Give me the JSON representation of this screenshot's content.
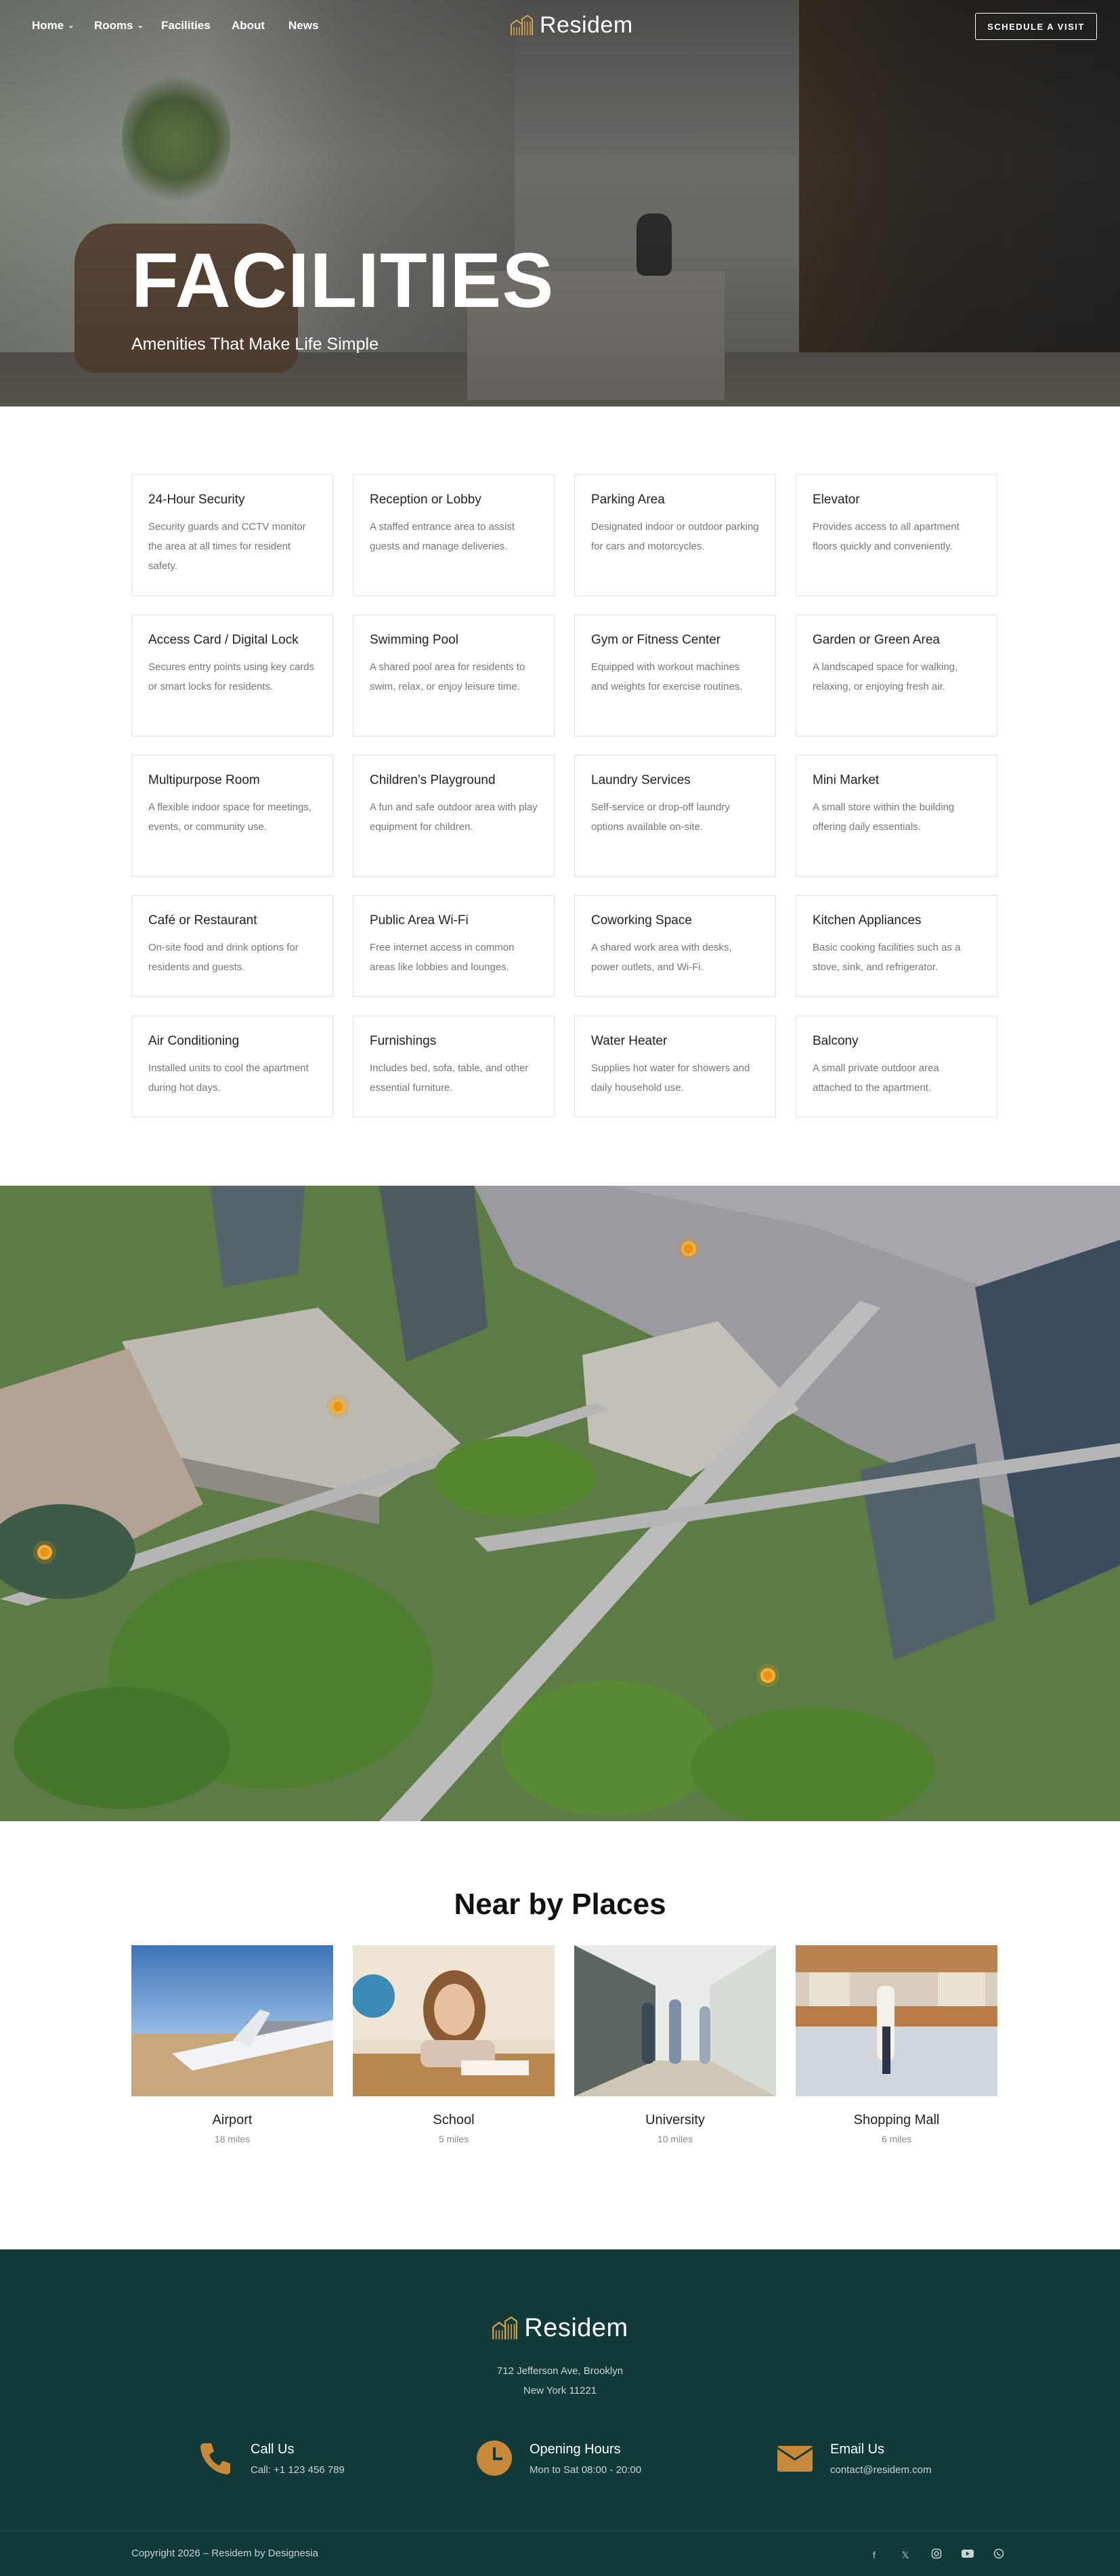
{
  "nav": {
    "items": [
      {
        "label": "Home",
        "has_dropdown": true
      },
      {
        "label": "Rooms",
        "has_dropdown": true
      },
      {
        "label": "Facilities",
        "has_dropdown": false
      },
      {
        "label": "About",
        "has_dropdown": false
      },
      {
        "label": "News",
        "has_dropdown": false
      }
    ],
    "brand": "Residem",
    "cta_label": "SCHEDULE A VISIT"
  },
  "hero": {
    "title": "FACILITIES",
    "subtitle": "Amenities That Make Life Simple"
  },
  "facilities": [
    {
      "title": "24-Hour Security",
      "desc": "Security guards and CCTV monitor the area at all times for resident safety."
    },
    {
      "title": "Reception or Lobby",
      "desc": "A staffed entrance area to assist guests and manage deliveries."
    },
    {
      "title": "Parking Area",
      "desc": "Designated indoor or outdoor parking for cars and motorcycles."
    },
    {
      "title": "Elevator",
      "desc": "Provides access to all apartment floors quickly and conveniently."
    },
    {
      "title": "Access Card / Digital Lock",
      "desc": "Secures entry points using key cards or smart locks for residents."
    },
    {
      "title": "Swimming Pool",
      "desc": "A shared pool area for residents to swim, relax, or enjoy leisure time."
    },
    {
      "title": "Gym or Fitness Center",
      "desc": "Equipped with workout machines and weights for exercise routines."
    },
    {
      "title": "Garden or Green Area",
      "desc": "A landscaped space for walking, relaxing, or enjoying fresh air."
    },
    {
      "title": "Multipurpose Room",
      "desc": "A flexible indoor space for meetings, events, or community use."
    },
    {
      "title": "Children’s Playground",
      "desc": "A fun and safe outdoor area with play equipment for children."
    },
    {
      "title": "Laundry Services",
      "desc": "Self-service or drop-off laundry options available on-site."
    },
    {
      "title": "Mini Market",
      "desc": "A small store within the building offering daily essentials."
    },
    {
      "title": "Café or Restaurant",
      "desc": "On-site food and drink options for residents and guests."
    },
    {
      "title": "Public Area Wi-Fi",
      "desc": "Free internet access in common areas like lobbies and lounges."
    },
    {
      "title": "Coworking Space",
      "desc": "A shared work area with desks, power outlets, and Wi-Fi."
    },
    {
      "title": "Kitchen Appliances",
      "desc": "Basic cooking facilities such as a stove, sink, and refrigerator."
    },
    {
      "title": "Air Conditioning",
      "desc": "Installed units to cool the apartment during hot days."
    },
    {
      "title": "Furnishings",
      "desc": "Includes bed, sofa, table, and other essential furniture."
    },
    {
      "title": "Water Heater",
      "desc": "Supplies hot water for showers and daily household use."
    },
    {
      "title": "Balcony",
      "desc": "A small private outdoor area attached to the apartment."
    }
  ],
  "nearby": {
    "title": "Near by Places",
    "places": [
      {
        "name": "Airport",
        "distance": "18 miles"
      },
      {
        "name": "School",
        "distance": "5 miles"
      },
      {
        "name": "University",
        "distance": "10 miles"
      },
      {
        "name": "Shopping Mall",
        "distance": "6 miles"
      }
    ]
  },
  "footer": {
    "brand": "Residem",
    "address_line1": "712 Jefferson Ave, Brooklyn",
    "address_line2": "New York 11221",
    "contacts": [
      {
        "title": "Call Us",
        "text": "Call: +1 123 456 789",
        "icon": "phone-icon"
      },
      {
        "title": "Opening Hours",
        "text": "Mon to Sat 08:00 - 20:00",
        "icon": "clock-icon"
      },
      {
        "title": "Email Us",
        "text": "contact@residem.com",
        "icon": "envelope-icon"
      }
    ],
    "copyright": "Copyright 2026 – Residem by Designesia",
    "socials": [
      "facebook-icon",
      "x-icon",
      "instagram-icon",
      "youtube-icon",
      "whatsapp-icon"
    ]
  },
  "colors": {
    "footer_bg": "#123a39",
    "accent": "#c88a3a",
    "map_pin": "#e89418"
  }
}
